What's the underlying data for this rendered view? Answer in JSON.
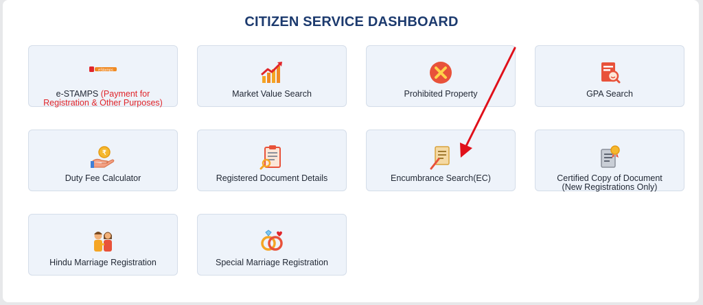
{
  "dashboard": {
    "title": "CITIZEN SERVICE DASHBOARD"
  },
  "cards": {
    "estamps": {
      "label_main": "e-STAMPS",
      "label_sub_1": "(Payment for",
      "label_sub_2": "Registration & Other Purposes)",
      "logo_text": "eStamps",
      "icon": "estamps-logo-icon"
    },
    "market_value": {
      "label": "Market Value Search",
      "icon": "bar-chart-growth-icon"
    },
    "prohibited": {
      "label": "Prohibited Property",
      "icon": "prohibited-x-icon"
    },
    "gpa": {
      "label": "GPA Search",
      "icon": "document-search-icon"
    },
    "duty_fee": {
      "label": "Duty Fee Calculator",
      "icon": "hand-coin-icon"
    },
    "registered_doc": {
      "label": "Registered Document Details",
      "icon": "clipboard-search-icon"
    },
    "encumbrance": {
      "label": "Encumbrance Search(EC)",
      "icon": "document-pen-icon"
    },
    "certified_copy": {
      "label_1": "Certified Copy of Document",
      "label_2": "(New Registrations Only)",
      "icon": "certificate-icon"
    },
    "hindu_marriage": {
      "label": "Hindu Marriage Registration",
      "icon": "couple-icon"
    },
    "special_marriage": {
      "label": "Special Marriage Registration",
      "icon": "rings-icon"
    }
  },
  "colors": {
    "title": "#1c3a6e",
    "card_bg": "#eef3fa",
    "accent_red": "#e0252a",
    "annotation_arrow": "#e0101a"
  }
}
